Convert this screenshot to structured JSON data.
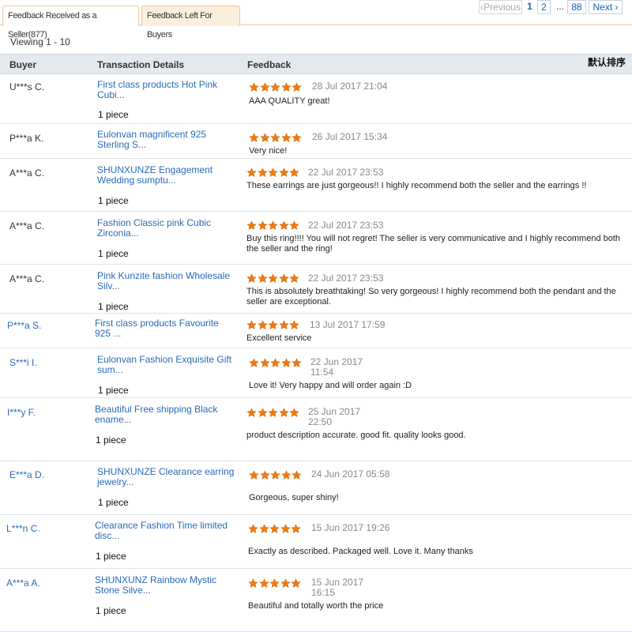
{
  "tabs": [
    {
      "label": "Feedback Received as a Seller(877)",
      "active": true
    },
    {
      "label": "Feedback Left For Buyers",
      "active": false
    }
  ],
  "viewing": "Viewing 1 - 10",
  "pagination": {
    "previous": "Previous",
    "pages": [
      "1",
      "2"
    ],
    "ellipsis": "...",
    "last": "88",
    "next": "Next",
    "current": "1"
  },
  "sort_label": "默认排序",
  "columns": {
    "buyer": "Buyer",
    "transaction": "Transaction Details",
    "feedback": "Feedback"
  },
  "colors": {
    "link": "#2a6ab8",
    "star": "#f07a10",
    "header_bg": "#e4e9ee"
  },
  "rows": [
    {
      "buyer": "U***s C.",
      "product": "First class products Hot Pink Cubi...",
      "qty": "1 piece",
      "rating": 5,
      "date": "28 Jul 2017 21:04",
      "feedback": "AAA QUALITY great!"
    },
    {
      "buyer": "P***a K.",
      "product": "Eulonvan magnificent 925 Sterling S...",
      "qty": "",
      "rating": 5,
      "date": "26 Jul 2017 15:34",
      "feedback": "Very nice!"
    },
    {
      "buyer": "A***a C.",
      "product": "SHUNXUNZE Engagement Wedding sumptu...",
      "qty": "1 piece",
      "rating": 5,
      "date": "22 Jul 2017 23:53",
      "feedback": "These earrings are just gorgeous!! I highly recommend both the seller and the earrings !!"
    },
    {
      "buyer": "A***a C.",
      "product": "Fashion Classic pink Cubic Zirconia...",
      "qty": "1 piece",
      "rating": 5,
      "date": "22 Jul 2017 23:53",
      "feedback": "Buy this ring!!!! You will not regret! The seller is very communicative and I highly recommend both the seller and the ring!"
    },
    {
      "buyer": "A***a C.",
      "product": "Pink Kunzite fashion Wholesale Silv...",
      "qty": "1 piece",
      "rating": 5,
      "date": "22 Jul 2017 23:53",
      "feedback": "This is absolutely breathtaking! So very gorgeous! I highly recommend both the pendant and the seller are exceptional."
    },
    {
      "buyer": "P***a S.",
      "product": "First class products Favourite 925 ...",
      "qty": "",
      "rating": 5,
      "date": "13 Jul 2017 17:59",
      "feedback": "Excellent service"
    },
    {
      "buyer": "S***i I.",
      "product": "Eulonvan Fashion Exquisite Gift sum...",
      "qty": "1 piece",
      "rating": 5,
      "date": "22 Jun 2017 11:54",
      "feedback": "Love it! Very happy and will order again :D"
    },
    {
      "buyer": "I***y F.",
      "product": "Beautiful Free shipping Black ename...",
      "qty": "1 piece",
      "rating": 5,
      "date": "25 Jun 2017 22:50",
      "feedback": "product description accurate. good fit. quality looks good."
    },
    {
      "buyer": "E***a D.",
      "product": "SHUNXUNZE Clearance earring jewelry...",
      "qty": "1 piece",
      "rating": 5,
      "date": "24 Jun 2017 05:58",
      "feedback": "Gorgeous, super shiny!"
    },
    {
      "buyer": "L***n C.",
      "product": "Clearance Fashion Time limited disc...",
      "qty": "1 piece",
      "rating": 5,
      "date": "15 Jun 2017 19:26",
      "feedback": "Exactly as described. Packaged well. Love it. Many thanks"
    },
    {
      "buyer": "A***a A.",
      "product": "SHUNXUNZ Rainbow Mystic Stone Silve...",
      "qty": "1 piece",
      "rating": 5,
      "date": "15 Jun 2017 16:15",
      "feedback": "Beautiful and totally worth the price"
    }
  ]
}
